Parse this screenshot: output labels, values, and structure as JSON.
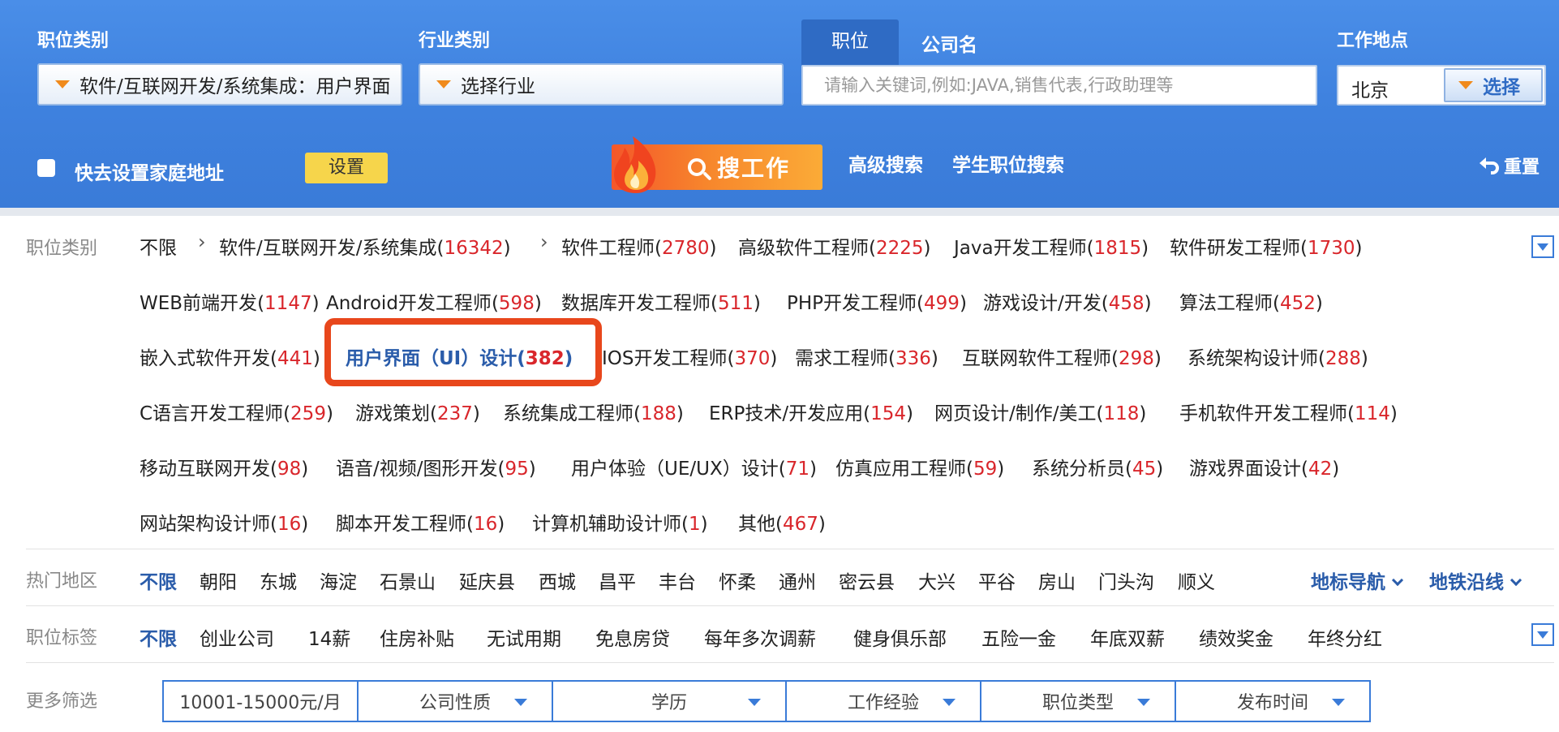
{
  "header": {
    "job_category_label": "职位类别",
    "job_category_value": "软件/互联网开发/系统集成：用户界面",
    "industry_label": "行业类别",
    "industry_value": "选择行业",
    "tab_position": "职位",
    "tab_company": "公司名",
    "keyword_placeholder": "请输入关键词,例如:JAVA,销售代表,行政助理等",
    "location_label": "工作地点",
    "location_city": "北京",
    "location_button": "选择",
    "home_checkbox_label": "快去设置家庭地址",
    "set_button": "设置",
    "search_button": "搜工作",
    "advanced_search": "高级搜索",
    "student_search": "学生职位搜索",
    "reset": "重置"
  },
  "job_category_row": {
    "label": "职位类别",
    "unlimited": "不限",
    "items": [
      {
        "name": "软件/互联网开发/系统集成",
        "count": "16342"
      },
      {
        "name": "软件工程师",
        "count": "2780"
      },
      {
        "name": "高级软件工程师",
        "count": "2225"
      },
      {
        "name": "Java开发工程师",
        "count": "1815"
      },
      {
        "name": "软件研发工程师",
        "count": "1730"
      },
      {
        "name": "WEB前端开发",
        "count": "1147"
      },
      {
        "name": "Android开发工程师",
        "count": "598"
      },
      {
        "name": "数据库开发工程师",
        "count": "511"
      },
      {
        "name": "PHP开发工程师",
        "count": "499"
      },
      {
        "name": "游戏设计/开发",
        "count": "458"
      },
      {
        "name": "算法工程师",
        "count": "452"
      },
      {
        "name": "嵌入式软件开发",
        "count": "441"
      },
      {
        "name": "用户界面（UI）设计",
        "count": "382"
      },
      {
        "name": "IOS开发工程师",
        "count": "370"
      },
      {
        "name": "需求工程师",
        "count": "336"
      },
      {
        "name": "互联网软件工程师",
        "count": "298"
      },
      {
        "name": "系统架构设计师",
        "count": "288"
      },
      {
        "name": "C语言开发工程师",
        "count": "259"
      },
      {
        "name": "游戏策划",
        "count": "237"
      },
      {
        "name": "系统集成工程师",
        "count": "188"
      },
      {
        "name": "ERP技术/开发应用",
        "count": "154"
      },
      {
        "name": "网页设计/制作/美工",
        "count": "118"
      },
      {
        "name": "手机软件开发工程师",
        "count": "114"
      },
      {
        "name": "移动互联网开发",
        "count": "98"
      },
      {
        "name": "语音/视频/图形开发",
        "count": "95"
      },
      {
        "name": "用户体验（UE/UX）设计",
        "count": "71"
      },
      {
        "name": "仿真应用工程师",
        "count": "59"
      },
      {
        "name": "系统分析员",
        "count": "45"
      },
      {
        "name": "游戏界面设计",
        "count": "42"
      },
      {
        "name": "网站架构设计师",
        "count": "16"
      },
      {
        "name": "脚本开发工程师",
        "count": "16"
      },
      {
        "name": "计算机辅助设计师",
        "count": "1"
      },
      {
        "name": "其他",
        "count": "467"
      }
    ]
  },
  "hot_area_row": {
    "label": "热门地区",
    "unlimited": "不限",
    "items": [
      "朝阳",
      "东城",
      "海淀",
      "石景山",
      "延庆县",
      "西城",
      "昌平",
      "丰台",
      "怀柔",
      "通州",
      "密云县",
      "大兴",
      "平谷",
      "房山",
      "门头沟",
      "顺义"
    ],
    "landmark_nav": "地标导航",
    "subway_line": "地铁沿线"
  },
  "tag_row": {
    "label": "职位标签",
    "unlimited": "不限",
    "items": [
      "创业公司",
      "14薪",
      "住房补贴",
      "无试用期",
      "免息房贷",
      "每年多次调薪",
      "健身俱乐部",
      "五险一金",
      "年底双薪",
      "绩效奖金",
      "年终分红"
    ]
  },
  "more_filters": {
    "label": "更多筛选",
    "cells": [
      "10001-15000元/月",
      "公司性质",
      "学历",
      "工作经验",
      "职位类型",
      "发布时间"
    ]
  }
}
